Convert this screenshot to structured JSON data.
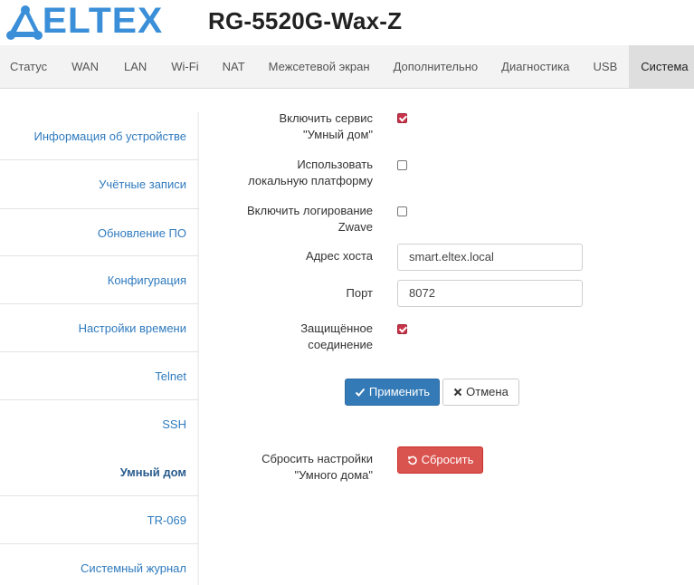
{
  "brand": {
    "logo_text": "ELTEX"
  },
  "device": {
    "model": "RG-5520G-Wax-Z"
  },
  "nav": {
    "tabs": [
      {
        "label": "Статус"
      },
      {
        "label": "WAN"
      },
      {
        "label": "LAN"
      },
      {
        "label": "Wi-Fi"
      },
      {
        "label": "NAT"
      },
      {
        "label": "Межсетевой экран"
      },
      {
        "label": "Дополнительно"
      },
      {
        "label": "Диагностика"
      },
      {
        "label": "USB"
      },
      {
        "label": "Система"
      }
    ],
    "active_tab": "Система"
  },
  "sidebar": {
    "items": [
      {
        "label": "Информация об устройстве"
      },
      {
        "label": "Учётные записи"
      },
      {
        "label": "Обновление ПО"
      },
      {
        "label": "Конфигурация"
      },
      {
        "label": "Настройки времени"
      },
      {
        "label": "Telnet"
      },
      {
        "label": "SSH"
      },
      {
        "label": "Умный дом"
      },
      {
        "label": "TR-069"
      },
      {
        "label": "Системный журнал"
      }
    ],
    "active_item": "Умный дом"
  },
  "form": {
    "enable_service": {
      "label_line1": "Включить сервис",
      "label_line2": "\"Умный дом\"",
      "checked": true
    },
    "local_platform": {
      "label_line1": "Использовать",
      "label_line2": "локальную платформу",
      "checked": false
    },
    "zwave_logging": {
      "label_line1": "Включить логирование",
      "label_line2": "Zwave",
      "checked": false
    },
    "host_address": {
      "label": "Адрес хоста",
      "value": "smart.eltex.local"
    },
    "port": {
      "label": "Порт",
      "value": "8072"
    },
    "secure_connection": {
      "label_line1": "Защищённое",
      "label_line2": "соединение",
      "checked": true
    },
    "apply_label": "Применить",
    "cancel_label": "Отмена",
    "reset": {
      "label_line1": "Сбросить настройки",
      "label_line2": "\"Умного дома\"",
      "button_label": "Сбросить"
    }
  },
  "colors": {
    "logo": "#3a8fd8",
    "link": "#2f7bbf",
    "primary": "#337ab7",
    "danger": "#d9534f",
    "checkbox_checked": "#c8334a"
  }
}
